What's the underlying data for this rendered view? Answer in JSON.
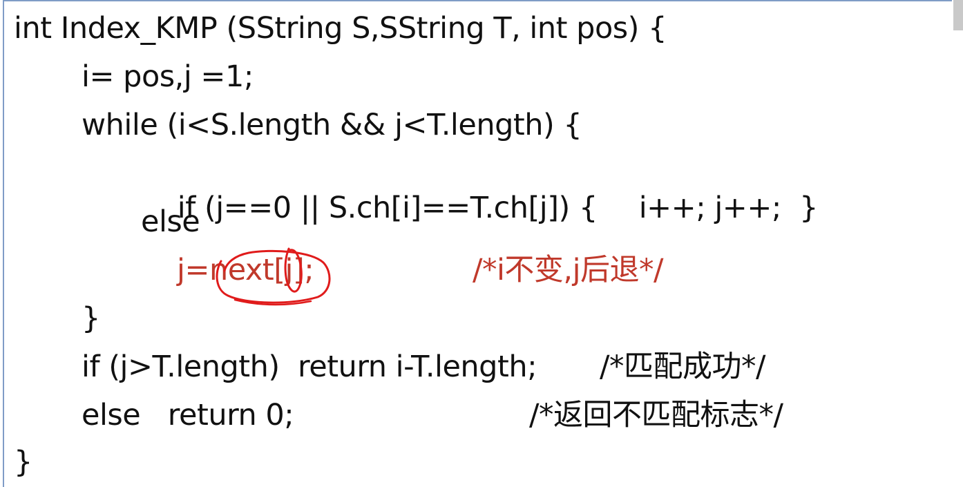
{
  "code": {
    "line1": "int Index_KMP (SString S,SString T, int pos) {",
    "line2": "i= pos,j =1;",
    "line3": "while (i<S.length && j<T.length) {",
    "line4_a": "if (j==0 || S.ch[i]==T.ch[j]) {",
    "line4_b": "i++; j++;  }",
    "line5": "else",
    "line6_code": "j=next[j];",
    "line6_comment": "/*i不变,j后退*/",
    "line7": "}",
    "line8_code": "if (j>T.length)  return i-T.length;",
    "line8_comment": "/*匹配成功*/",
    "line9_code": "else   return 0;",
    "line9_comment": "/*返回不匹配标志*/",
    "line10": "}"
  },
  "colors": {
    "text": "#111111",
    "highlight": "#c0392b",
    "annotation": "#e01b1b",
    "frame": "#7f9cc6"
  }
}
